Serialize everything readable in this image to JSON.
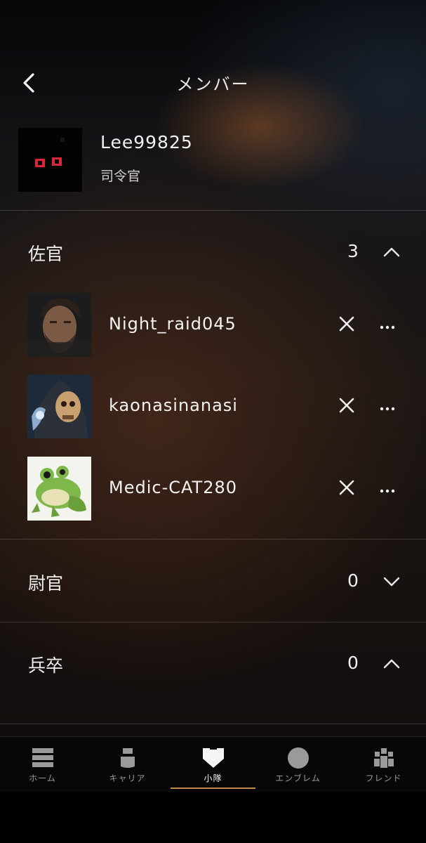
{
  "header": {
    "title": "メンバー"
  },
  "leader": {
    "name": "Lee99825",
    "role": "司令官"
  },
  "sections": [
    {
      "title": "佐官",
      "count": "3",
      "expanded": true,
      "members": [
        {
          "name": "Night_raid045"
        },
        {
          "name": "kaonasinanasi"
        },
        {
          "name": "Medic-CAT280"
        }
      ]
    },
    {
      "title": "尉官",
      "count": "0",
      "expanded": false,
      "members": []
    },
    {
      "title": "兵卒",
      "count": "0",
      "expanded": true,
      "members": []
    }
  ],
  "tabs": [
    {
      "label": "ホーム",
      "icon": "home-icon"
    },
    {
      "label": "キャリア",
      "icon": "career-icon"
    },
    {
      "label": "小隊",
      "icon": "squad-icon",
      "active": true
    },
    {
      "label": "エンブレム",
      "icon": "emblem-icon"
    },
    {
      "label": "フレンド",
      "icon": "friends-icon"
    }
  ],
  "colors": {
    "accent": "#c08a50",
    "leader_eyes": "#d8263a"
  }
}
